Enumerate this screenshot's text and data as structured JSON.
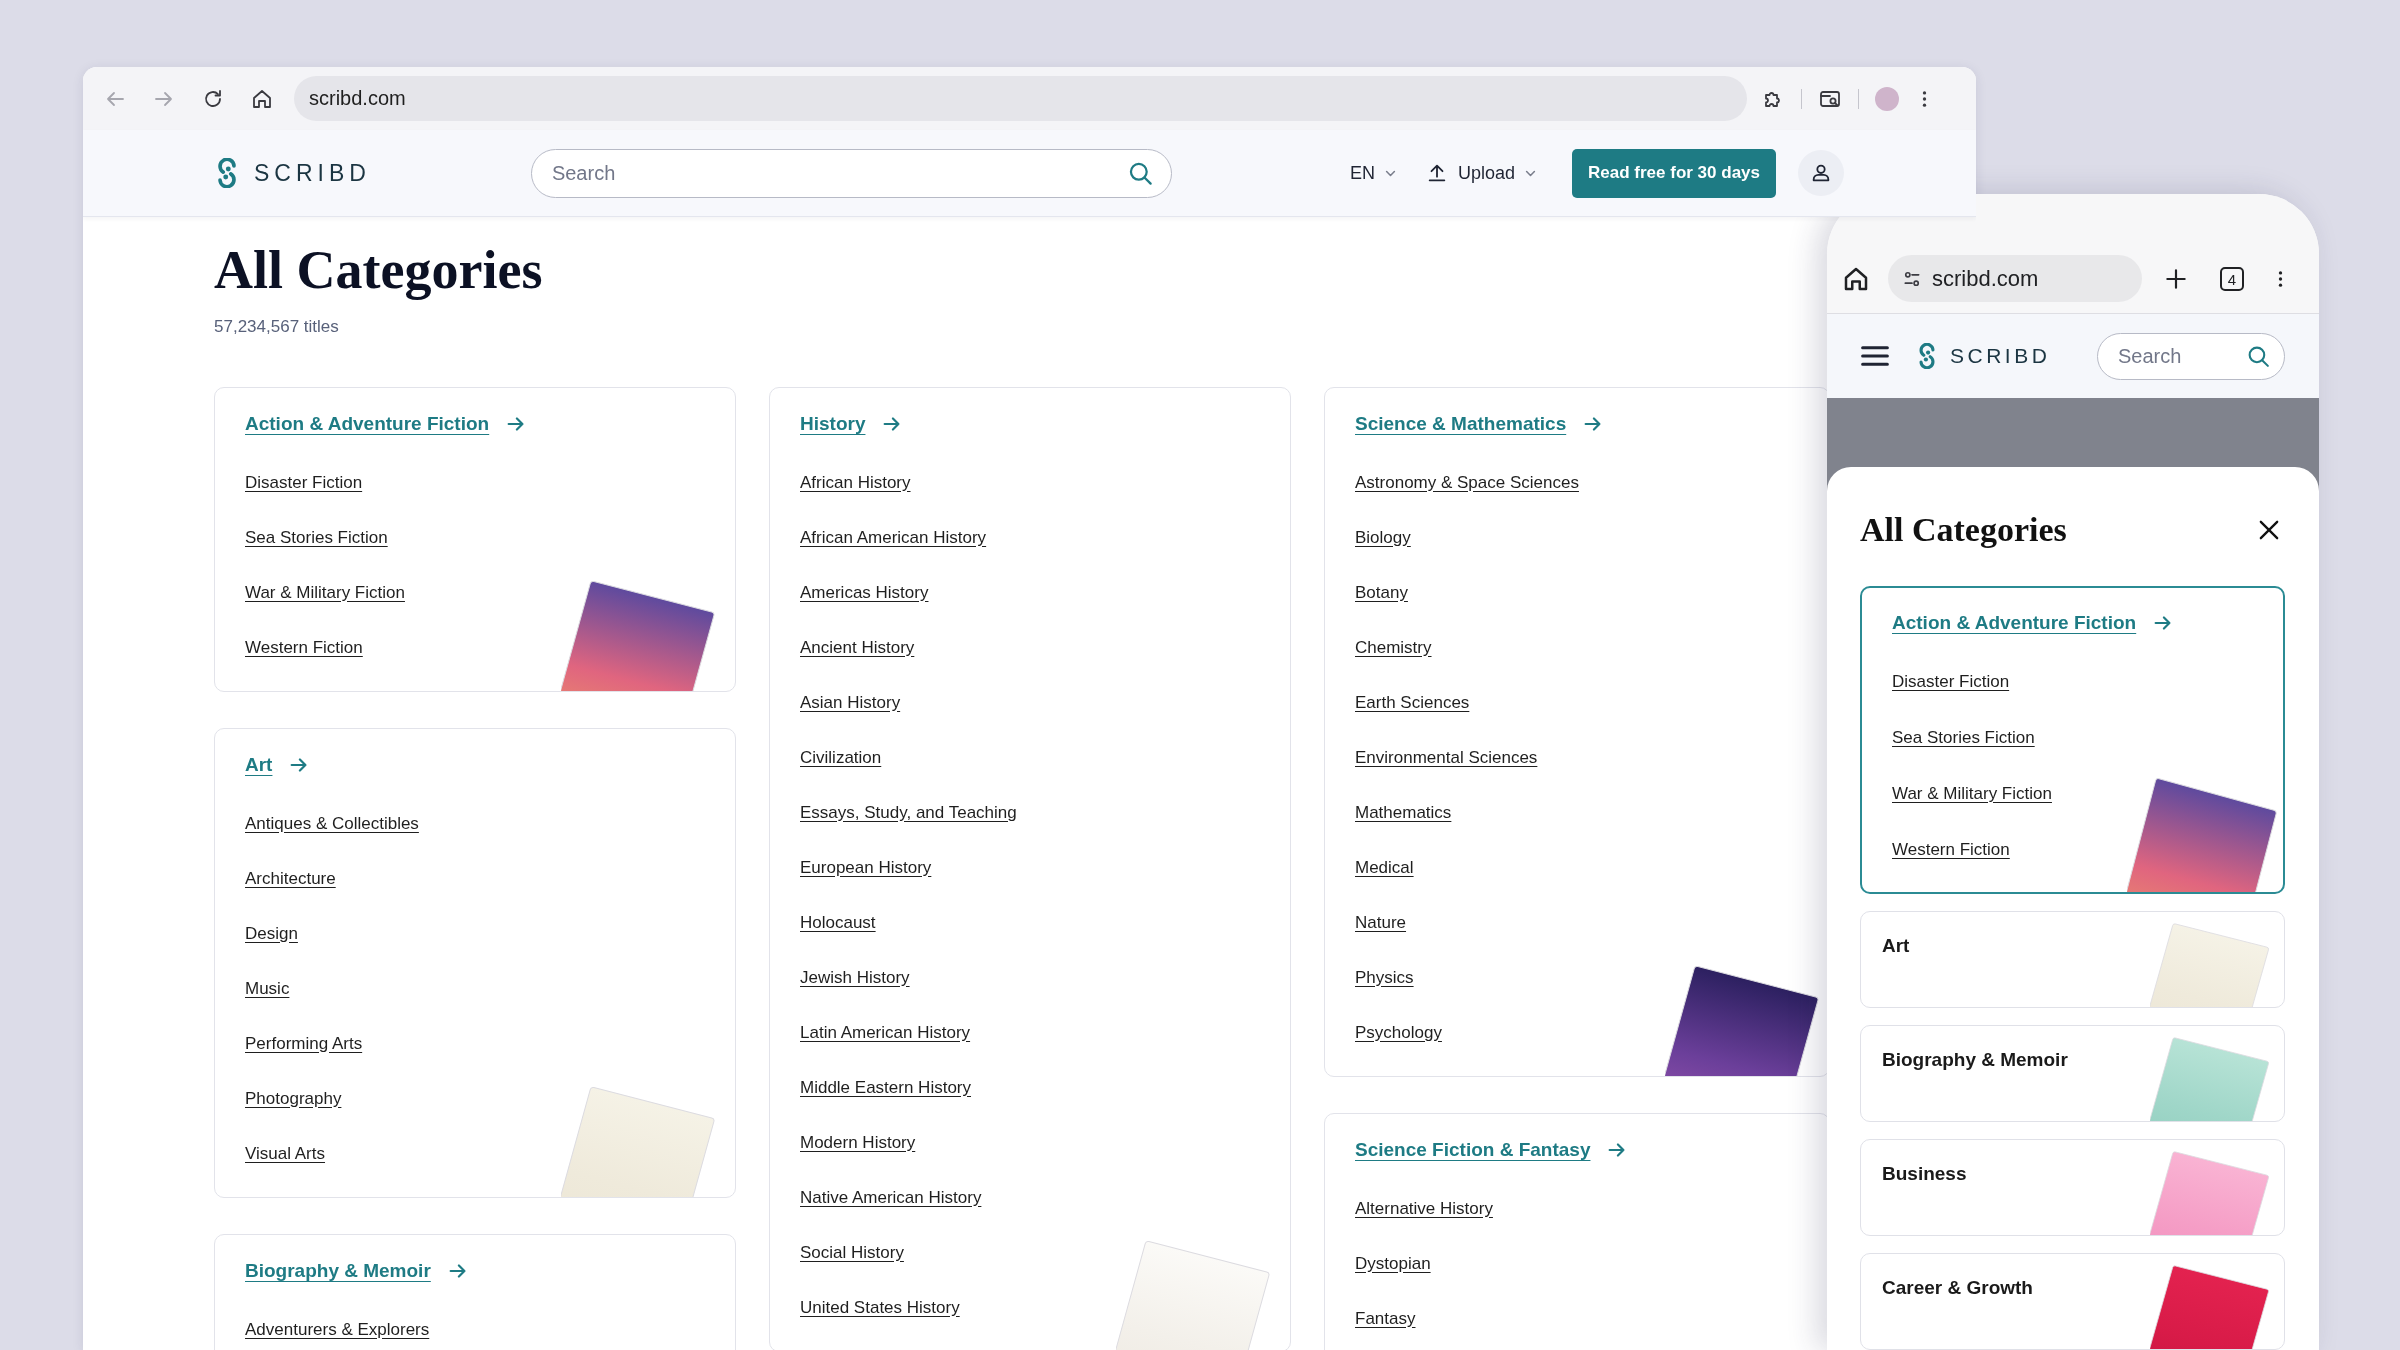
{
  "browser": {
    "toolbar_buttons": [
      {
        "kind": "back",
        "disabled": true
      },
      {
        "kind": "forward",
        "disabled": true
      },
      {
        "kind": "reload",
        "disabled": false
      },
      {
        "kind": "home",
        "disabled": false
      }
    ],
    "url": "scribd.com"
  },
  "site_header": {
    "logo": "SCRIBD",
    "search": {
      "placeholder": "Search"
    },
    "language": "EN",
    "upload": "Upload",
    "cta": "Read free for 30 days"
  },
  "page": {
    "title": "All Categories",
    "count": "57,234,567 titles",
    "columns": [
      {
        "cards": [
          {
            "title": "Action & Adventure Fiction",
            "items": [
              "Disaster Fiction",
              "Sea Stories Fiction",
              "War & Military Fiction",
              "Western Fiction"
            ],
            "cover": true
          },
          {
            "title": "Art",
            "items": [
              "Antiques & Collectibles",
              "Architecture",
              "Design",
              "Music",
              "Performing Arts",
              "Photography",
              "Visual Arts"
            ],
            "cover": true
          },
          {
            "title": "Biography & Memoir",
            "items": [
              "Adventurers & Explorers"
            ],
            "cover": false
          }
        ]
      },
      {
        "cards": [
          {
            "title": "History",
            "items": [
              "African History",
              "African American History",
              "Americas History",
              "Ancient History",
              "Asian History",
              "Civilization",
              "Essays, Study, and Teaching",
              "European History",
              "Holocaust",
              "Jewish History",
              "Latin American History",
              "Middle Eastern History",
              "Modern History",
              "Native American History",
              "Social History",
              "United States History"
            ],
            "cover": true
          }
        ]
      },
      {
        "cards": [
          {
            "title": "Science & Mathematics",
            "items": [
              "Astronomy & Space Sciences",
              "Biology",
              "Botany",
              "Chemistry",
              "Earth Sciences",
              "Environmental Sciences",
              "Mathematics",
              "Medical",
              "Nature",
              "Physics",
              "Psychology"
            ],
            "cover": true
          },
          {
            "title": "Science Fiction & Fantasy",
            "items": [
              "Alternative History",
              "Dystopian",
              "Fantasy"
            ],
            "cover": false
          }
        ]
      }
    ]
  },
  "phone": {
    "url": "scribd.com",
    "tab_count": "4",
    "logo": "SCRIBD",
    "search": {
      "placeholder": "Search"
    },
    "sheet": {
      "title": "All Categories",
      "cards": [
        {
          "title": "Action & Adventure Fiction",
          "expanded": true,
          "items": [
            "Disaster Fiction",
            "Sea Stories Fiction",
            "War & Military Fiction",
            "Western Fiction"
          ],
          "cover": true
        },
        {
          "title": "Art",
          "expanded": false,
          "cover": true
        },
        {
          "title": "Biography & Memoir",
          "expanded": false,
          "cover": true
        },
        {
          "title": "Business",
          "expanded": false,
          "cover": true
        },
        {
          "title": "Career & Growth",
          "expanded": false,
          "cover": true
        }
      ]
    }
  }
}
